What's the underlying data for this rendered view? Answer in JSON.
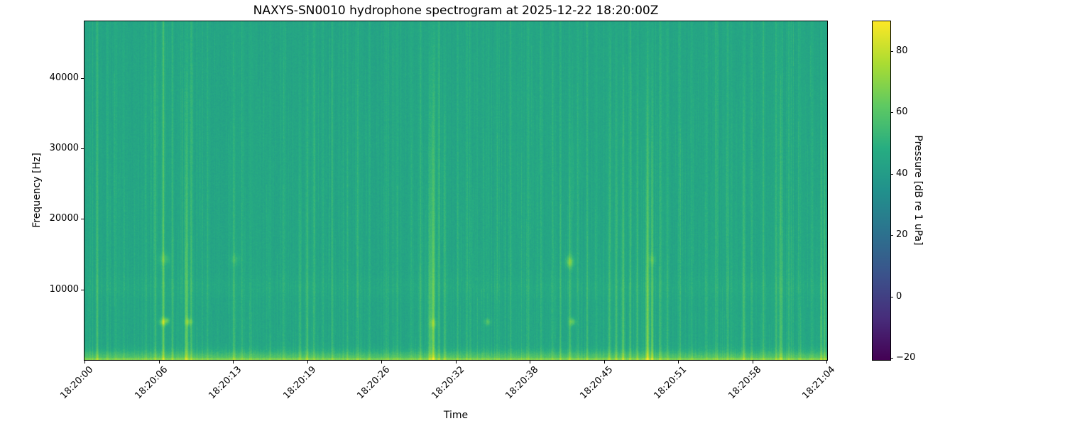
{
  "chart_data": {
    "type": "heatmap",
    "subtype": "spectrogram",
    "title": "NAXYS-SN0010 hydrophone spectrogram at 2025-12-22 18:20:00Z",
    "xlabel": "Time",
    "ylabel": "Frequency [Hz]",
    "x_tick_labels": [
      "18:20:00",
      "18:20:06",
      "18:20:13",
      "18:20:19",
      "18:20:26",
      "18:20:32",
      "18:20:38",
      "18:20:45",
      "18:20:51",
      "18:20:58",
      "18:21:04"
    ],
    "y_ticks_hz": [
      10000,
      20000,
      30000,
      40000
    ],
    "y_range_hz": [
      0,
      48000
    ],
    "duration_seconds": 64.1,
    "grid": false,
    "colorbar": {
      "label": "Pressure [dB re 1 uPa]",
      "ticks": [
        80,
        60,
        40,
        20,
        0,
        -20
      ],
      "vmin": -20.6,
      "vmax": 89.7,
      "position": "right"
    },
    "colormap": {
      "name": "viridis",
      "stops": [
        "#440154",
        "#472d7b",
        "#3b528b",
        "#2c728e",
        "#21918c",
        "#27ad81",
        "#5ec962",
        "#aadc32",
        "#fde725"
      ]
    },
    "background_level_db": 44.3,
    "pixel_noise_db": 2.3,
    "column_noise_db": 1.4,
    "bands": {
      "low_freq_boost_db": 16,
      "low_freq_sigma_hz": 1150,
      "bottom_edge_boost_db": 6,
      "bottom_edge_cutoff_hz": 260,
      "mid_band_center_hz": 10300,
      "mid_band_sigma_hz": 1500,
      "mid_band_boost_db": 1.6
    },
    "transient_events": [
      {
        "t": 1.1,
        "g": 10,
        "p": "f"
      },
      {
        "t": 2.0,
        "g": 5,
        "p": "f"
      },
      {
        "t": 2.7,
        "g": 4,
        "p": "f"
      },
      {
        "t": 3.4,
        "g": 4,
        "p": "f"
      },
      {
        "t": 5.3,
        "g": 5,
        "p": "f"
      },
      {
        "t": 6.1,
        "g": 7,
        "p": "f"
      },
      {
        "t": 6.8,
        "g": 12,
        "p": "f",
        "w": 0.12
      },
      {
        "t": 7.6,
        "g": 8,
        "p": "f"
      },
      {
        "t": 8.8,
        "g": 14,
        "p": "l",
        "w": 0.14
      },
      {
        "t": 9.2,
        "g": 9,
        "p": "f"
      },
      {
        "t": 10.6,
        "g": 5,
        "p": "f"
      },
      {
        "t": 12.9,
        "g": 9,
        "p": "l"
      },
      {
        "t": 13.6,
        "g": 5,
        "p": "f"
      },
      {
        "t": 14.3,
        "g": 4,
        "p": "f"
      },
      {
        "t": 16.0,
        "g": 4,
        "p": "f"
      },
      {
        "t": 17.2,
        "g": 5,
        "p": "f"
      },
      {
        "t": 18.6,
        "g": 8,
        "p": "l"
      },
      {
        "t": 19.2,
        "g": 9,
        "p": "l"
      },
      {
        "t": 19.8,
        "g": 7,
        "p": "f"
      },
      {
        "t": 20.6,
        "g": 5,
        "p": "f"
      },
      {
        "t": 21.4,
        "g": 6,
        "p": "f"
      },
      {
        "t": 22.7,
        "g": 5,
        "p": "f"
      },
      {
        "t": 23.6,
        "g": 6,
        "p": "f"
      },
      {
        "t": 24.6,
        "g": 4,
        "p": "f"
      },
      {
        "t": 26.1,
        "g": 5,
        "p": "f"
      },
      {
        "t": 27.0,
        "g": 4,
        "p": "f"
      },
      {
        "t": 28.2,
        "g": 5,
        "p": "f"
      },
      {
        "t": 29.0,
        "g": 7,
        "p": "f"
      },
      {
        "t": 29.8,
        "g": 13,
        "p": "l",
        "w": 0.12
      },
      {
        "t": 30.1,
        "g": 18,
        "p": "l",
        "w": 0.14
      },
      {
        "t": 30.6,
        "g": 8,
        "p": "f"
      },
      {
        "t": 31.1,
        "g": 9,
        "p": "l"
      },
      {
        "t": 32.2,
        "g": 5,
        "p": "f"
      },
      {
        "t": 33.0,
        "g": 5,
        "p": "f"
      },
      {
        "t": 34.8,
        "g": 3,
        "p": "f"
      },
      {
        "t": 35.6,
        "g": 4,
        "p": "f"
      },
      {
        "t": 36.8,
        "g": 4,
        "p": "f"
      },
      {
        "t": 38.3,
        "g": 6,
        "p": "f"
      },
      {
        "t": 39.4,
        "g": 5,
        "p": "f"
      },
      {
        "t": 40.4,
        "g": 5,
        "p": "f"
      },
      {
        "t": 41.1,
        "g": 7,
        "p": "f"
      },
      {
        "t": 41.9,
        "g": 9,
        "p": "l",
        "w": 0.12
      },
      {
        "t": 42.6,
        "g": 5,
        "p": "f"
      },
      {
        "t": 43.4,
        "g": 7,
        "p": "f"
      },
      {
        "t": 44.2,
        "g": 5,
        "p": "f"
      },
      {
        "t": 45.3,
        "g": 9,
        "p": "l"
      },
      {
        "t": 45.9,
        "g": 10,
        "p": "l"
      },
      {
        "t": 46.5,
        "g": 13,
        "p": "l",
        "w": 0.12
      },
      {
        "t": 47.1,
        "g": 9,
        "p": "f"
      },
      {
        "t": 47.7,
        "g": 8,
        "p": "l"
      },
      {
        "t": 48.6,
        "g": 20,
        "p": "l",
        "w": 0.14
      },
      {
        "t": 49.0,
        "g": 16,
        "p": "l",
        "w": 0.1
      },
      {
        "t": 49.7,
        "g": 8,
        "p": "f"
      },
      {
        "t": 50.3,
        "g": 7,
        "p": "f"
      },
      {
        "t": 51.4,
        "g": 5,
        "p": "f"
      },
      {
        "t": 52.4,
        "g": 4,
        "p": "f"
      },
      {
        "t": 53.7,
        "g": 5,
        "p": "f"
      },
      {
        "t": 54.6,
        "g": 5,
        "p": "f"
      },
      {
        "t": 55.5,
        "g": 5,
        "p": "f"
      },
      {
        "t": 56.9,
        "g": 10,
        "p": "l",
        "w": 0.12
      },
      {
        "t": 57.6,
        "g": 7,
        "p": "f"
      },
      {
        "t": 58.6,
        "g": 5,
        "p": "f"
      },
      {
        "t": 59.7,
        "g": 8,
        "p": "f"
      },
      {
        "t": 60.1,
        "g": 12,
        "p": "l",
        "w": 0.13
      },
      {
        "t": 60.8,
        "g": 7,
        "p": "f"
      },
      {
        "t": 61.8,
        "g": 5,
        "p": "f"
      },
      {
        "t": 62.8,
        "g": 5,
        "p": "f"
      },
      {
        "t": 63.6,
        "g": 9,
        "p": "l"
      },
      {
        "t": 63.9,
        "g": 8,
        "p": "l"
      }
    ],
    "tonal_blobs": [
      {
        "t": 6.8,
        "f": 5400,
        "bw": 550,
        "g": 20,
        "w": 0.35
      },
      {
        "t": 7.15,
        "f": 5600,
        "bw": 420,
        "g": 12,
        "w": 0.22
      },
      {
        "t": 9.0,
        "f": 5400,
        "bw": 520,
        "g": 16,
        "w": 0.3
      },
      {
        "t": 6.9,
        "f": 14300,
        "bw": 900,
        "g": 9,
        "w": 0.5
      },
      {
        "t": 13.0,
        "f": 14200,
        "bw": 800,
        "g": 6,
        "w": 0.45
      },
      {
        "t": 30.1,
        "f": 5200,
        "bw": 700,
        "g": 10,
        "w": 0.3
      },
      {
        "t": 34.8,
        "f": 5400,
        "bw": 450,
        "g": 13,
        "w": 0.25
      },
      {
        "t": 41.9,
        "f": 13900,
        "bw": 800,
        "g": 18,
        "w": 0.35
      },
      {
        "t": 42.1,
        "f": 5400,
        "bw": 520,
        "g": 16,
        "w": 0.3
      },
      {
        "t": 49.0,
        "f": 14200,
        "bw": 700,
        "g": 8,
        "w": 0.3
      }
    ]
  }
}
